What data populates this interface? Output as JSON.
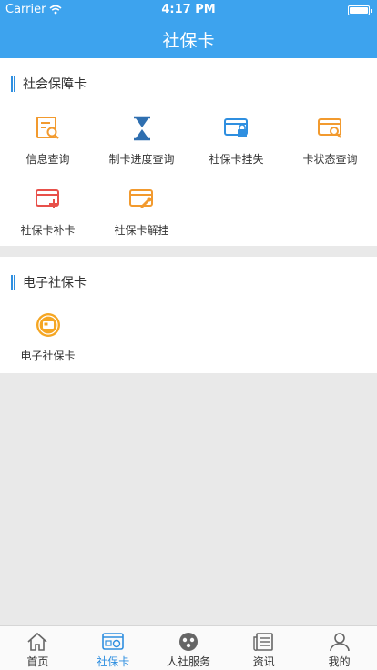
{
  "status_bar": {
    "carrier": "Carrier",
    "time": "4:17 PM",
    "battery_level": 1.0
  },
  "nav": {
    "title": "社保卡"
  },
  "section_social_card": {
    "title": "社会保障卡",
    "items": [
      {
        "label": "信息查询",
        "icon": "document-search-icon"
      },
      {
        "label": "制卡进度查询",
        "icon": "hourglass-icon"
      },
      {
        "label": "社保卡挂失",
        "icon": "card-lock-icon"
      },
      {
        "label": "卡状态查询",
        "icon": "card-search-icon"
      },
      {
        "label": "社保卡补卡",
        "icon": "card-add-icon"
      },
      {
        "label": "社保卡解挂",
        "icon": "card-unlock-icon"
      }
    ]
  },
  "section_e_card": {
    "title": "电子社保卡",
    "items": [
      {
        "label": "电子社保卡",
        "icon": "e-card-badge-icon"
      }
    ]
  },
  "tabbar": {
    "items": [
      {
        "label": "首页",
        "icon": "home-icon"
      },
      {
        "label": "社保卡",
        "icon": "social-card-icon"
      },
      {
        "label": "人社服务",
        "icon": "service-icon"
      },
      {
        "label": "资讯",
        "icon": "news-icon"
      },
      {
        "label": "我的",
        "icon": "profile-icon"
      }
    ],
    "active_index": 1
  },
  "colors": {
    "header": "#3da3ee",
    "accent": "#2f8fe0",
    "orange": "#f29a2e",
    "red": "#e8504a"
  }
}
